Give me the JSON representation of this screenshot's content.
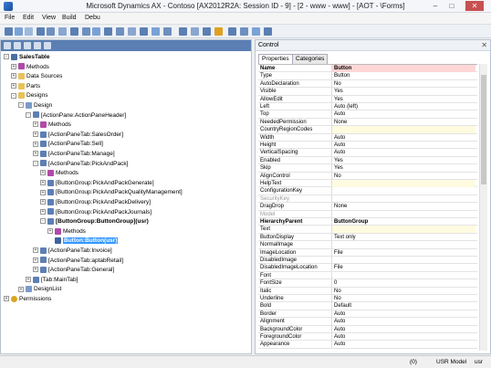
{
  "window": {
    "title": "Microsoft Dynamics AX - Contoso [AX2012R2A: Session ID - 9] - [2 - www - www] - [AOT - \\Forms]",
    "minimize": "–",
    "maximize": "□",
    "close": "✕"
  },
  "menu": [
    "File",
    "Edit",
    "View",
    "Build",
    "Debu"
  ],
  "tree": [
    {
      "label": "SalesTable",
      "level": 0,
      "icon": "form",
      "exp": "-",
      "bold": true
    },
    {
      "label": "Methods",
      "level": 1,
      "icon": "methods",
      "exp": "+"
    },
    {
      "label": "Data Sources",
      "level": 1,
      "icon": "folder",
      "exp": "+"
    },
    {
      "label": "Parts",
      "level": 1,
      "icon": "folder",
      "exp": "+"
    },
    {
      "label": "Designs",
      "level": 1,
      "icon": "folder",
      "exp": "-"
    },
    {
      "label": "Design",
      "level": 2,
      "icon": "design",
      "exp": "-"
    },
    {
      "label": "[ActionPane:ActionPaneHeader]",
      "level": 3,
      "icon": "group",
      "exp": "-"
    },
    {
      "label": "Methods",
      "level": 4,
      "icon": "methods",
      "exp": "+"
    },
    {
      "label": "[ActionPaneTab:SalesOrder]",
      "level": 4,
      "icon": "group",
      "exp": "+"
    },
    {
      "label": "[ActionPaneTab:Sell]",
      "level": 4,
      "icon": "group",
      "exp": "+"
    },
    {
      "label": "[ActionPaneTab:Manage]",
      "level": 4,
      "icon": "group",
      "exp": "+"
    },
    {
      "label": "[ActionPaneTab:PickAndPack]",
      "level": 4,
      "icon": "group",
      "exp": "-"
    },
    {
      "label": "Methods",
      "level": 5,
      "icon": "methods",
      "exp": "+"
    },
    {
      "label": "[ButtonGroup:PickAndPackGenerate]",
      "level": 5,
      "icon": "group",
      "exp": "+"
    },
    {
      "label": "[ButtonGroup:PickAndPackQualityManagement]",
      "level": 5,
      "icon": "group",
      "exp": "+"
    },
    {
      "label": "[ButtonGroup:PickAndPackDelivery]",
      "level": 5,
      "icon": "group",
      "exp": "+"
    },
    {
      "label": "[ButtonGroup:PickAndPackJournals]",
      "level": 5,
      "icon": "group",
      "exp": "+"
    },
    {
      "label": "[ButtonGroup:ButtonGroup](usr)",
      "level": 5,
      "icon": "group",
      "exp": "-",
      "bold": true
    },
    {
      "label": "Methods",
      "level": 6,
      "icon": "methods",
      "exp": "+"
    },
    {
      "label": "Button:Button(usr)",
      "level": 6,
      "icon": "button",
      "exp": "",
      "selected": true
    },
    {
      "label": "[ActionPaneTab:Invoice]",
      "level": 4,
      "icon": "group",
      "exp": "+"
    },
    {
      "label": "[ActionPaneTab:aptabRetail]",
      "level": 4,
      "icon": "group",
      "exp": "+"
    },
    {
      "label": "[ActionPaneTab:General]",
      "level": 4,
      "icon": "group",
      "exp": "+"
    },
    {
      "label": "[Tab:MainTab]",
      "level": 3,
      "icon": "group",
      "exp": "+"
    },
    {
      "label": "DesignList",
      "level": 2,
      "icon": "design",
      "exp": "+"
    },
    {
      "label": "Permissions",
      "level": 0,
      "icon": "perm",
      "exp": "+"
    }
  ],
  "properties_panel": {
    "title": "Control",
    "close": "✕",
    "tabs": [
      "Properties",
      "Categories"
    ],
    "rows": [
      {
        "name": "Name",
        "value": "Button",
        "style": "header"
      },
      {
        "name": "Type",
        "value": "Button"
      },
      {
        "name": "AutoDeclaration",
        "value": "No"
      },
      {
        "name": "Visible",
        "value": "Yes"
      },
      {
        "name": "AllowEdit",
        "value": "Yes"
      },
      {
        "name": "Left",
        "value": "Auto (left)"
      },
      {
        "name": "Top",
        "value": "Auto"
      },
      {
        "name": "NeededPermission",
        "value": "None"
      },
      {
        "name": "CountryRegionCodes",
        "value": "",
        "style": "yellow"
      },
      {
        "name": "Width",
        "value": "Auto"
      },
      {
        "name": "Height",
        "value": "Auto"
      },
      {
        "name": "VerticalSpacing",
        "value": "Auto"
      },
      {
        "name": "Enabled",
        "value": "Yes"
      },
      {
        "name": "Skip",
        "value": "Yes"
      },
      {
        "name": "AlignControl",
        "value": "No"
      },
      {
        "name": "HelpText",
        "value": "",
        "style": "yellow"
      },
      {
        "name": "ConfigurationKey",
        "value": ""
      },
      {
        "name": "SecurityKey",
        "value": "",
        "style": "grey"
      },
      {
        "name": "DragDrop",
        "value": "None"
      },
      {
        "name": "Model",
        "value": "",
        "style": "grey"
      },
      {
        "name": "HierarchyParent",
        "value": "ButtonGroup",
        "style": "header2"
      },
      {
        "name": "Text",
        "value": "",
        "style": "yellow"
      },
      {
        "name": "ButtonDisplay",
        "value": "Text only"
      },
      {
        "name": "NormalImage",
        "value": ""
      },
      {
        "name": "ImageLocation",
        "value": "File"
      },
      {
        "name": "DisabledImage",
        "value": ""
      },
      {
        "name": "DisabledImageLocation",
        "value": "File"
      },
      {
        "name": "Font",
        "value": ""
      },
      {
        "name": "FontSize",
        "value": "0"
      },
      {
        "name": "Italic",
        "value": "No"
      },
      {
        "name": "Underline",
        "value": "No"
      },
      {
        "name": "Bold",
        "value": "Default"
      },
      {
        "name": "Border",
        "value": "Auto"
      },
      {
        "name": "Alignment",
        "value": "Auto"
      },
      {
        "name": "BackgroundColor",
        "value": "Auto"
      },
      {
        "name": "ForegroundColor",
        "value": "Auto"
      },
      {
        "name": "Appearance",
        "value": "Auto"
      }
    ]
  },
  "statusbar": {
    "counter": "(0)",
    "model": "USR Model",
    "user": "usr"
  }
}
